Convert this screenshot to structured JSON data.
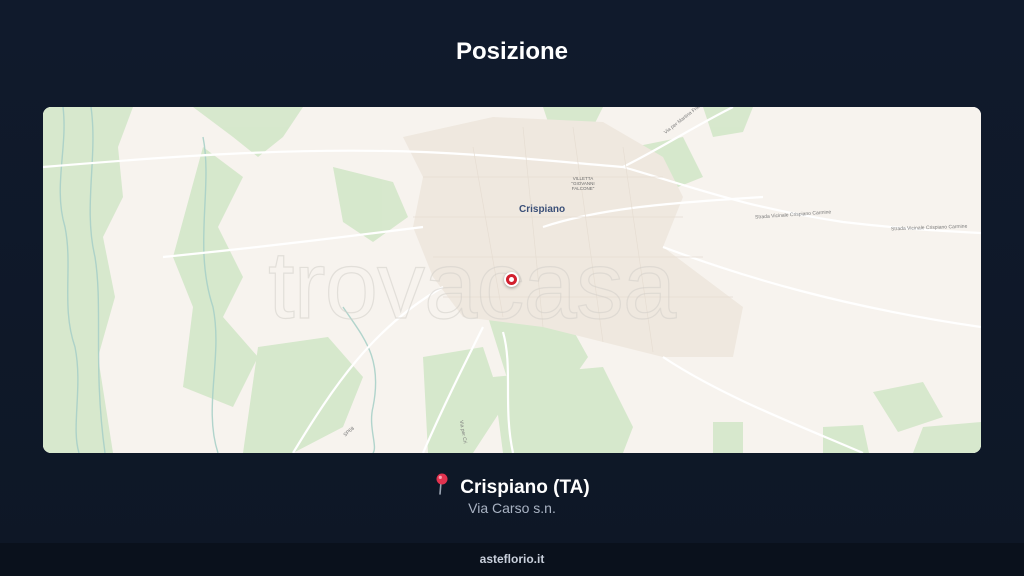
{
  "page": {
    "title": "Posizione"
  },
  "map": {
    "town_label": "Crispiano",
    "villetta_label": "VILLETTA \"GIOVANNI FALCONE\"",
    "road_labels": {
      "via_martina": "Via per Martina Franca",
      "strada_1": "Strada Vicinale Crispiano Carmine",
      "strada_2": "Strada Vicinale Crispiano Carmine",
      "sp": "SP68",
      "via_per": "Via per Cri"
    },
    "watermark": "trovacasa"
  },
  "location": {
    "pin_icon": "map-pin-icon",
    "name": "Crispiano (TA)",
    "address": "Via Carso s.n."
  },
  "footer": {
    "site": "asteflorio.it"
  },
  "colors": {
    "background": "#101a2c",
    "map_base": "#f7f3ee",
    "map_green": "#cfe4c4",
    "marker": "#d21f2d",
    "footer": "#0a111c"
  }
}
